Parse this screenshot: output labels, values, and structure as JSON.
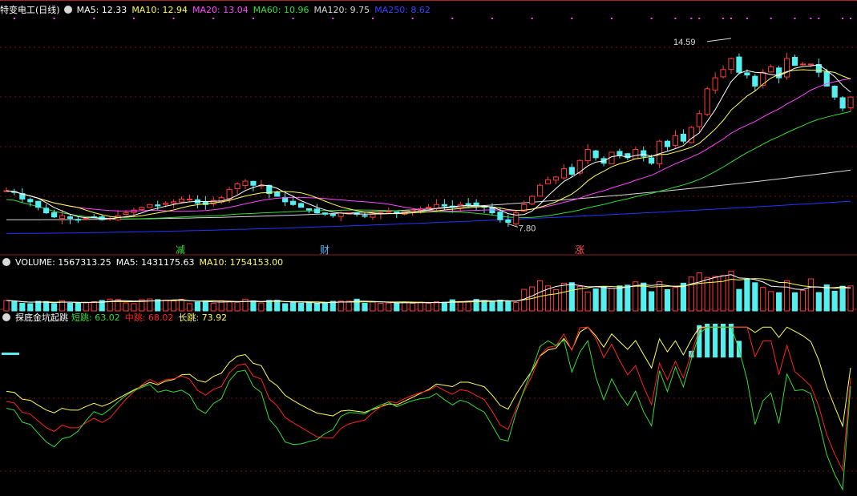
{
  "main_header": {
    "title": "特变电工(日线)",
    "ma5_label": "MA5: 12.33",
    "ma10_label": "MA10: 12.94",
    "ma20_label": "MA20: 13.04",
    "ma60_label": "MA60: 10.96",
    "ma120_label": "MA120: 9.75",
    "ma250_label": "MA250: 8.62"
  },
  "volume_header": {
    "volume_label": "VOLUME: 1567313.25",
    "ma5_label": "MA5: 1431175.63",
    "ma10_label": "MA10: 1754153.00"
  },
  "indicator_header": {
    "name": "探底金坑起跳",
    "short_label": "短跳: 63.02",
    "mid_label": "中跳: 68.02",
    "long_label": "长跳: 73.92"
  },
  "price_annotations": {
    "high_label": "14.59",
    "low_label": "7.80"
  },
  "event_markers": [
    {
      "text": "减",
      "color": "#33dd33"
    },
    {
      "text": "财",
      "color": "#5ab8ff"
    },
    {
      "text": "涨",
      "color": "#ff5555"
    }
  ],
  "colors": {
    "up": "#ff3b3b",
    "down": "#54f0f0",
    "ma5": "#ffffff",
    "ma10": "#ffff55",
    "ma20": "#ff44ff",
    "ma60": "#33dd33",
    "ma120": "#d8d8d8",
    "ma250": "#2233ff",
    "short_jump": "#33dd33",
    "mid_jump": "#ff2222",
    "long_jump": "#ffff55"
  },
  "chart_data": {
    "type": "candlestick",
    "title": "特变电工(日线)",
    "price_ylim": [
      7.2,
      15.4
    ],
    "price_high_marked": 14.59,
    "price_low_marked": 7.8,
    "closes": [
      9.0,
      8.95,
      8.7,
      8.6,
      8.4,
      8.2,
      8.05,
      8.1,
      8.0,
      7.95,
      8.0,
      8.05,
      7.95,
      8.0,
      8.1,
      8.2,
      8.3,
      8.4,
      8.5,
      8.45,
      8.55,
      8.6,
      8.7,
      8.7,
      8.55,
      8.5,
      8.65,
      8.75,
      9.05,
      9.25,
      9.35,
      9.2,
      9.2,
      8.9,
      8.8,
      8.6,
      8.5,
      8.4,
      8.3,
      8.2,
      8.15,
      8.1,
      8.2,
      8.2,
      8.15,
      8.1,
      8.15,
      8.2,
      8.25,
      8.2,
      8.25,
      8.3,
      8.35,
      8.4,
      8.5,
      8.45,
      8.4,
      8.5,
      8.5,
      8.45,
      8.4,
      8.2,
      7.95,
      7.85,
      8.2,
      8.5,
      8.8,
      9.2,
      9.4,
      9.5,
      9.8,
      9.6,
      10.1,
      10.5,
      10.2,
      10.0,
      10.4,
      10.3,
      10.2,
      10.5,
      10.25,
      10.0,
      10.8,
      10.6,
      11.0,
      10.8,
      11.3,
      11.8,
      12.7,
      13.1,
      13.4,
      13.8,
      13.3,
      13.2,
      12.8,
      13.3,
      13.5,
      13.1,
      13.8,
      13.55,
      13.6,
      13.6,
      13.3,
      12.8,
      12.4,
      12.0,
      12.4
    ],
    "last_close": 12.4,
    "ma5_last": 12.33,
    "ma10_last": 12.94,
    "ma20_last": 13.04,
    "ma60_last": 10.96,
    "ma120_last": 9.75,
    "ma250_last": 8.62,
    "volume_last": 1567313.25,
    "volume_ma5_last": 1431175.63,
    "volume_ma10_last": 1754153.0,
    "indicator_ylim": [
      0,
      100
    ],
    "indicator_series": [
      {
        "name": "短跳",
        "last": 63.02
      },
      {
        "name": "中跳",
        "last": 68.02
      },
      {
        "name": "长跳",
        "last": 73.92
      }
    ]
  }
}
